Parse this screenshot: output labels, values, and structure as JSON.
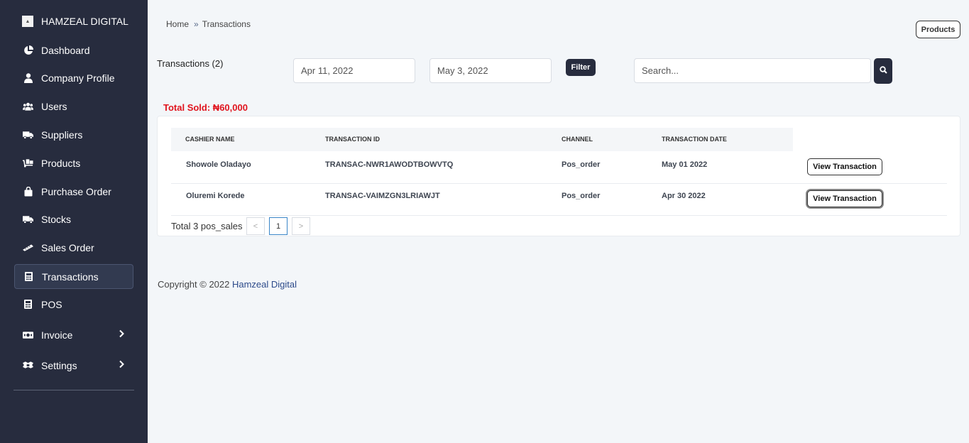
{
  "brand": {
    "name": "HAMZEAL DIGITAL"
  },
  "sidebar": {
    "items": [
      {
        "label": "Dashboard",
        "icon": "chart-pie-icon"
      },
      {
        "label": "Company Profile",
        "icon": "user-icon"
      },
      {
        "label": "Users",
        "icon": "users-icon"
      },
      {
        "label": "Suppliers",
        "icon": "truck-icon"
      },
      {
        "label": "Products",
        "icon": "dolly-icon"
      },
      {
        "label": "Purchase Order",
        "icon": "shopping-bag-icon"
      },
      {
        "label": "Stocks",
        "icon": "truck-icon"
      },
      {
        "label": "Sales Order",
        "icon": "ruler-icon"
      },
      {
        "label": "Transactions",
        "icon": "calculator-icon",
        "active": true
      },
      {
        "label": "POS",
        "icon": "calculator-icon"
      },
      {
        "label": "Invoice",
        "icon": "money-bill-icon",
        "expandable": true
      },
      {
        "label": "Settings",
        "icon": "toolbox-icon",
        "expandable": true
      }
    ]
  },
  "breadcrumb": {
    "home": "Home",
    "separator": "»",
    "current": "Transactions"
  },
  "header": {
    "products_button": "Products"
  },
  "filters": {
    "title": "Transactions (2)",
    "start_date": "Apr 11, 2022",
    "end_date": "May 3, 2022",
    "filter_button": "Filter",
    "search_placeholder": "Search..."
  },
  "summary": {
    "total_sold": "Total Sold: ₦60,000"
  },
  "table": {
    "headers": [
      "CASHIER NAME",
      "TRANSACTION ID",
      "CHANNEL",
      "TRANSACTION DATE"
    ],
    "rows": [
      {
        "cashier": "Showole Oladayo",
        "txn_id": "TRANSAC-NWR1AWODTBOWVTQ",
        "channel": "Pos_order",
        "date": "May 01 2022",
        "action": "View Transaction"
      },
      {
        "cashier": "Oluremi Korede",
        "txn_id": "TRANSAC-VAIMZGN3LRIAWJT",
        "channel": "Pos_order",
        "date": "Apr 30 2022",
        "action": "View Transaction"
      }
    ]
  },
  "pagination": {
    "total_text": "Total 3 pos_sales",
    "prev": "<",
    "current_page": "1",
    "next": ">"
  },
  "footer": {
    "copyright": "Copyright © 2022 ",
    "company": "Hamzeal Digital"
  },
  "colors": {
    "sidebar_bg": "#272c3e",
    "accent_dark": "#272c3e",
    "total_sold": "#e0141e",
    "link": "#2c4a8a"
  }
}
